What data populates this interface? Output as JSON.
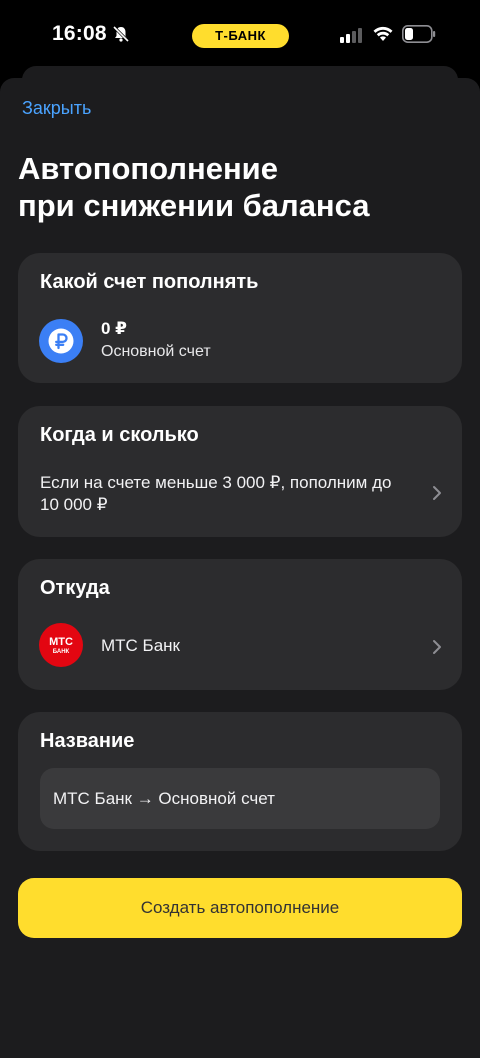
{
  "status_bar": {
    "time": "16:08",
    "bank_badge": "Т-БАНК",
    "icons": [
      "bell-slash-icon",
      "signal-icon",
      "wifi-icon",
      "battery-icon"
    ]
  },
  "header": {
    "close_label": "Закрыть",
    "title_line1": "Автопополнение",
    "title_line2": "при снижении баланса"
  },
  "account_card": {
    "title": "Какой счет пополнять",
    "amount": "0 ₽",
    "account_name": "Основной счет",
    "icon": "ruble-icon"
  },
  "rule_card": {
    "title": "Когда и сколько",
    "description": "Если на счете меньше 3 000 ₽, пополним до 10 000 ₽"
  },
  "source_card": {
    "title": "Откуда",
    "bank_name": "МТС Банк",
    "logo_text_1": "МТС",
    "logo_text_2": "БАНК"
  },
  "name_card": {
    "title": "Название",
    "value": "МТС Банк → Основной счет"
  },
  "create_button_label": "Создать автопополнение",
  "colors": {
    "background": "#000000",
    "sheet": "#1c1c1e",
    "card": "#2c2c2e",
    "accent_yellow": "#ffdd2d",
    "link_blue": "#4aa3ff",
    "ruble_icon": "#3b7ff5",
    "mts_red": "#e30611"
  }
}
